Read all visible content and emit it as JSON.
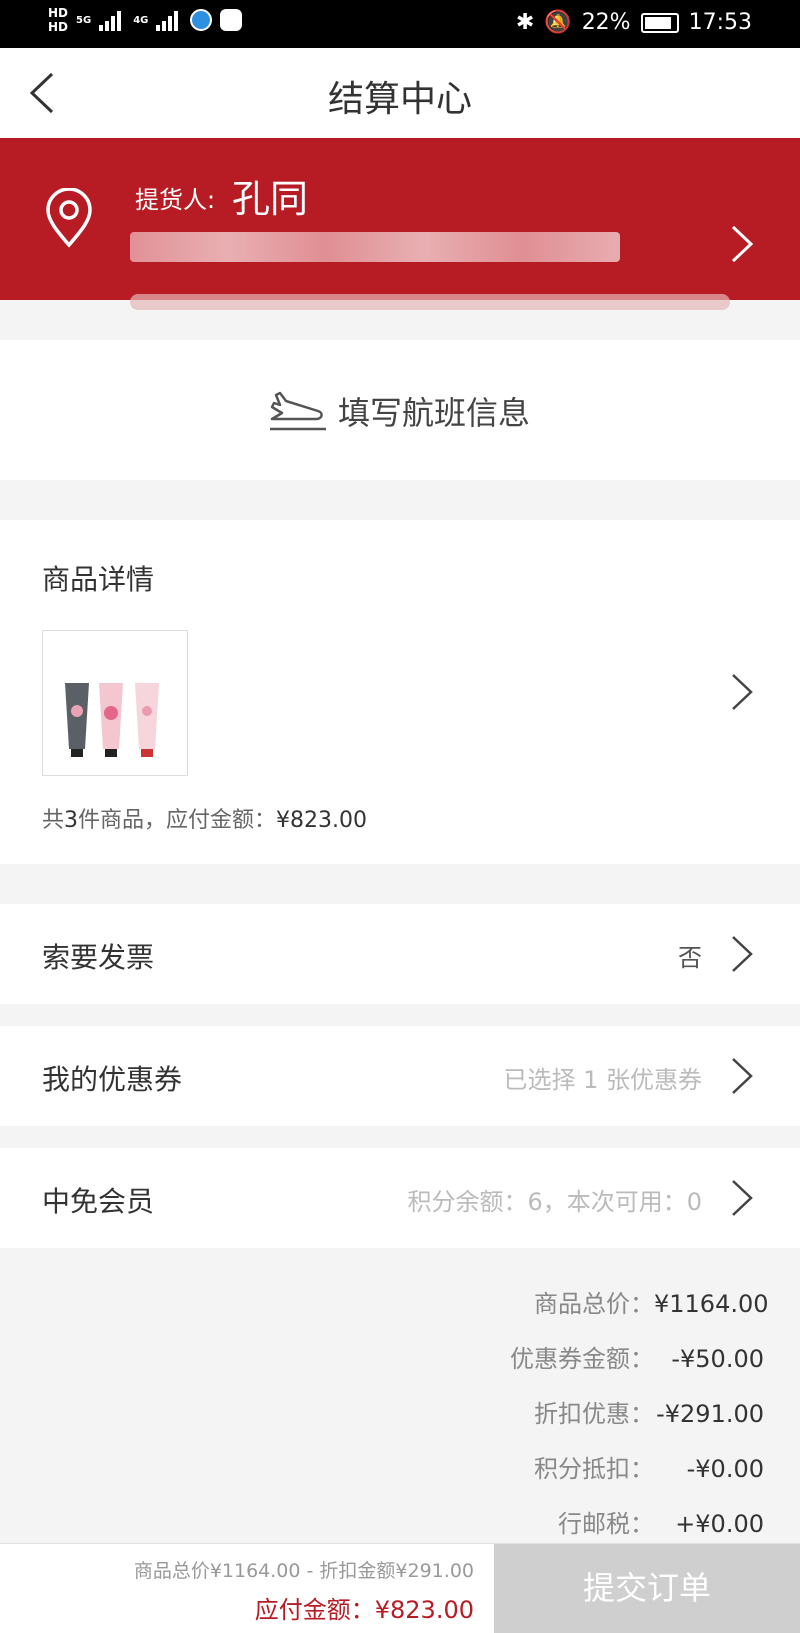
{
  "status_bar": {
    "network_left": "HD",
    "network_left2": "HD",
    "net_5g": "5G",
    "net_4g": "4G",
    "battery": "22%",
    "time": "17:53"
  },
  "header": {
    "title": "结算中心"
  },
  "address": {
    "label": "提货人:",
    "name": "孔同"
  },
  "flight": {
    "label": "填写航班信息"
  },
  "goods": {
    "heading": "商品详情",
    "summary_prefix": "共",
    "count": "3",
    "summary_mid": "件商品，应付金额：",
    "amount": "¥823.00"
  },
  "rows": {
    "invoice": {
      "label": "索要发票",
      "value": "否"
    },
    "coupon": {
      "label": "我的优惠券",
      "value": "已选择 1 张优惠券"
    },
    "member": {
      "label": "中免会员",
      "value": "积分余额：6，本次可用：0"
    }
  },
  "summary": [
    {
      "label": "商品总价：",
      "value": "¥1164.00"
    },
    {
      "label": "优惠券金额：",
      "value": "-¥50.00"
    },
    {
      "label": "折扣优惠：",
      "value": "-¥291.00"
    },
    {
      "label": "积分抵扣：",
      "value": "-¥0.00"
    },
    {
      "label": "行邮税：",
      "value": "+¥0.00"
    }
  ],
  "bottom": {
    "detail": "商品总价¥1164.00 - 折扣金额¥291.00",
    "payable": "应付金额：¥823.00",
    "submit": "提交订单"
  },
  "colors": {
    "accent": "#b71c24",
    "submit_disabled": "#cfcfcf"
  }
}
